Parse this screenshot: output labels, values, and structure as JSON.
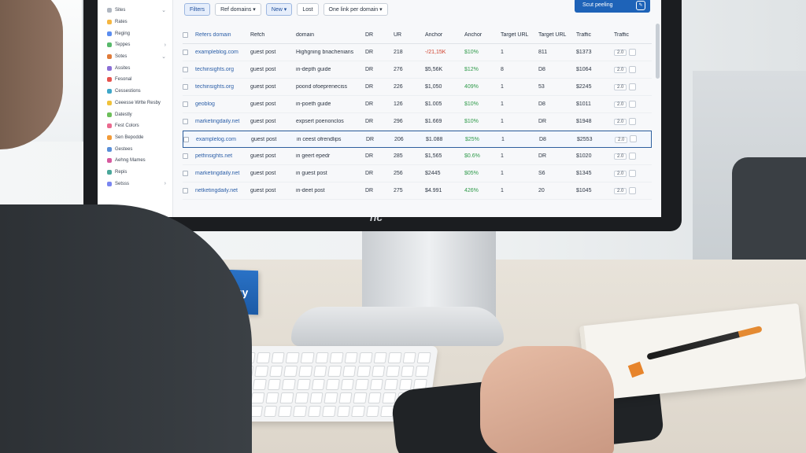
{
  "toolbar": {
    "filters": "Filters",
    "ref_domains": "Ref domains",
    "new": "New",
    "lost": "Lost",
    "one_link": "One link per domain",
    "cta": "Scut peeling"
  },
  "sidebar": {
    "items": [
      {
        "label": "Sites",
        "color": "#b0b7c1"
      },
      {
        "label": "Rates",
        "color": "#f5b642"
      },
      {
        "label": "Reging",
        "color": "#5b8def"
      },
      {
        "label": "Teppes",
        "color": "#58b96b"
      },
      {
        "label": "Sotes",
        "color": "#e07b39"
      },
      {
        "label": "Assites",
        "color": "#8b6fd6"
      },
      {
        "label": "Fesonal",
        "color": "#e6534e"
      },
      {
        "label": "Cessestions",
        "color": "#3fa7c9"
      },
      {
        "label": "Ceeesse Wrlte Resby",
        "color": "#f0c23b"
      },
      {
        "label": "Datestly",
        "color": "#6dbf5a"
      },
      {
        "label": "Fest Colors",
        "color": "#ea6a8f"
      },
      {
        "label": "Sen Bepodde",
        "color": "#f29b38"
      },
      {
        "label": "Gestees",
        "color": "#5a8fd8"
      },
      {
        "label": "Aehng Mames",
        "color": "#d65a9f"
      },
      {
        "label": "Repis",
        "color": "#4aa79a"
      },
      {
        "label": "Setsss",
        "color": "#7a86f0"
      }
    ]
  },
  "table": {
    "headers": [
      "Refers domain",
      "Refch",
      "domain",
      "DR",
      "UR",
      "Anchor",
      "Anchor",
      "Target URL",
      "Target URL",
      "Traffic",
      "Traffic"
    ],
    "rows": [
      {
        "domain": "exampleblog.com",
        "type": "guest post",
        "anchor": "Highgning bnachenians",
        "dr": "DR",
        "ur": "218",
        "val": "-/21,15K",
        "pct": "$10%",
        "n": "1",
        "t": "811",
        "traffic": "$1373",
        "pill": "2.0"
      },
      {
        "domain": "techinsights.org",
        "type": "guest post",
        "anchor": "in-depth guide",
        "dr": "DR",
        "ur": "276",
        "val": "$5,56K",
        "pct": "$12%",
        "n": "8",
        "t": "D8",
        "traffic": "$1064",
        "pill": "2.0"
      },
      {
        "domain": "techinsights.org",
        "type": "guest post",
        "anchor": "poond ofoepreneciss",
        "dr": "DR",
        "ur": "226",
        "val": "$1,050",
        "pct": "409%",
        "n": "1",
        "t": "53",
        "traffic": "$2245",
        "pill": "2.0"
      },
      {
        "domain": "geoblog",
        "type": "guest post",
        "anchor": "in-poeth guide",
        "dr": "DR",
        "ur": "126",
        "val": "$1.005",
        "pct": "$10%",
        "n": "1",
        "t": "D8",
        "traffic": "$1011",
        "pill": "2.0"
      },
      {
        "domain": "marketingdaily.net",
        "type": "guest post",
        "anchor": "expsert poenonclos",
        "dr": "DR",
        "ur": "296",
        "val": "$1.669",
        "pct": "$10%",
        "n": "1",
        "t": "DR",
        "traffic": "$1948",
        "pill": "2.0"
      },
      {
        "domain": "examplelog.com",
        "type": "guest post",
        "anchor": "in ceest ofrendlips",
        "dr": "DR",
        "ur": "206",
        "val": "$1.088",
        "pct": "$25%",
        "n": "1",
        "t": "D8",
        "traffic": "$2553",
        "pill": "2.0"
      },
      {
        "domain": "petfinsights.net",
        "type": "guest post",
        "anchor": "in geert epedr",
        "dr": "DR",
        "ur": "285",
        "val": "$1,565",
        "pct": "$0.6%",
        "n": "1",
        "t": "DR",
        "traffic": "$1020",
        "pill": "2.0"
      },
      {
        "domain": "marketingdaily.net",
        "type": "guest post",
        "anchor": "in guest post",
        "dr": "DR",
        "ur": "256",
        "val": "$2445",
        "pct": "$05%",
        "n": "1",
        "t": "S6",
        "traffic": "$1345",
        "pill": "2.0"
      },
      {
        "domain": "netketingdaily.net",
        "type": "guest post",
        "anchor": "in-deet post",
        "dr": "DR",
        "ur": "275",
        "val": "$4.991",
        "pct": "426%",
        "n": "1",
        "t": "20",
        "traffic": "$1045",
        "pill": "2.0"
      }
    ]
  },
  "monitor": {
    "brand": "hc"
  },
  "desk": {
    "nameplate": "Digital Strategy"
  }
}
